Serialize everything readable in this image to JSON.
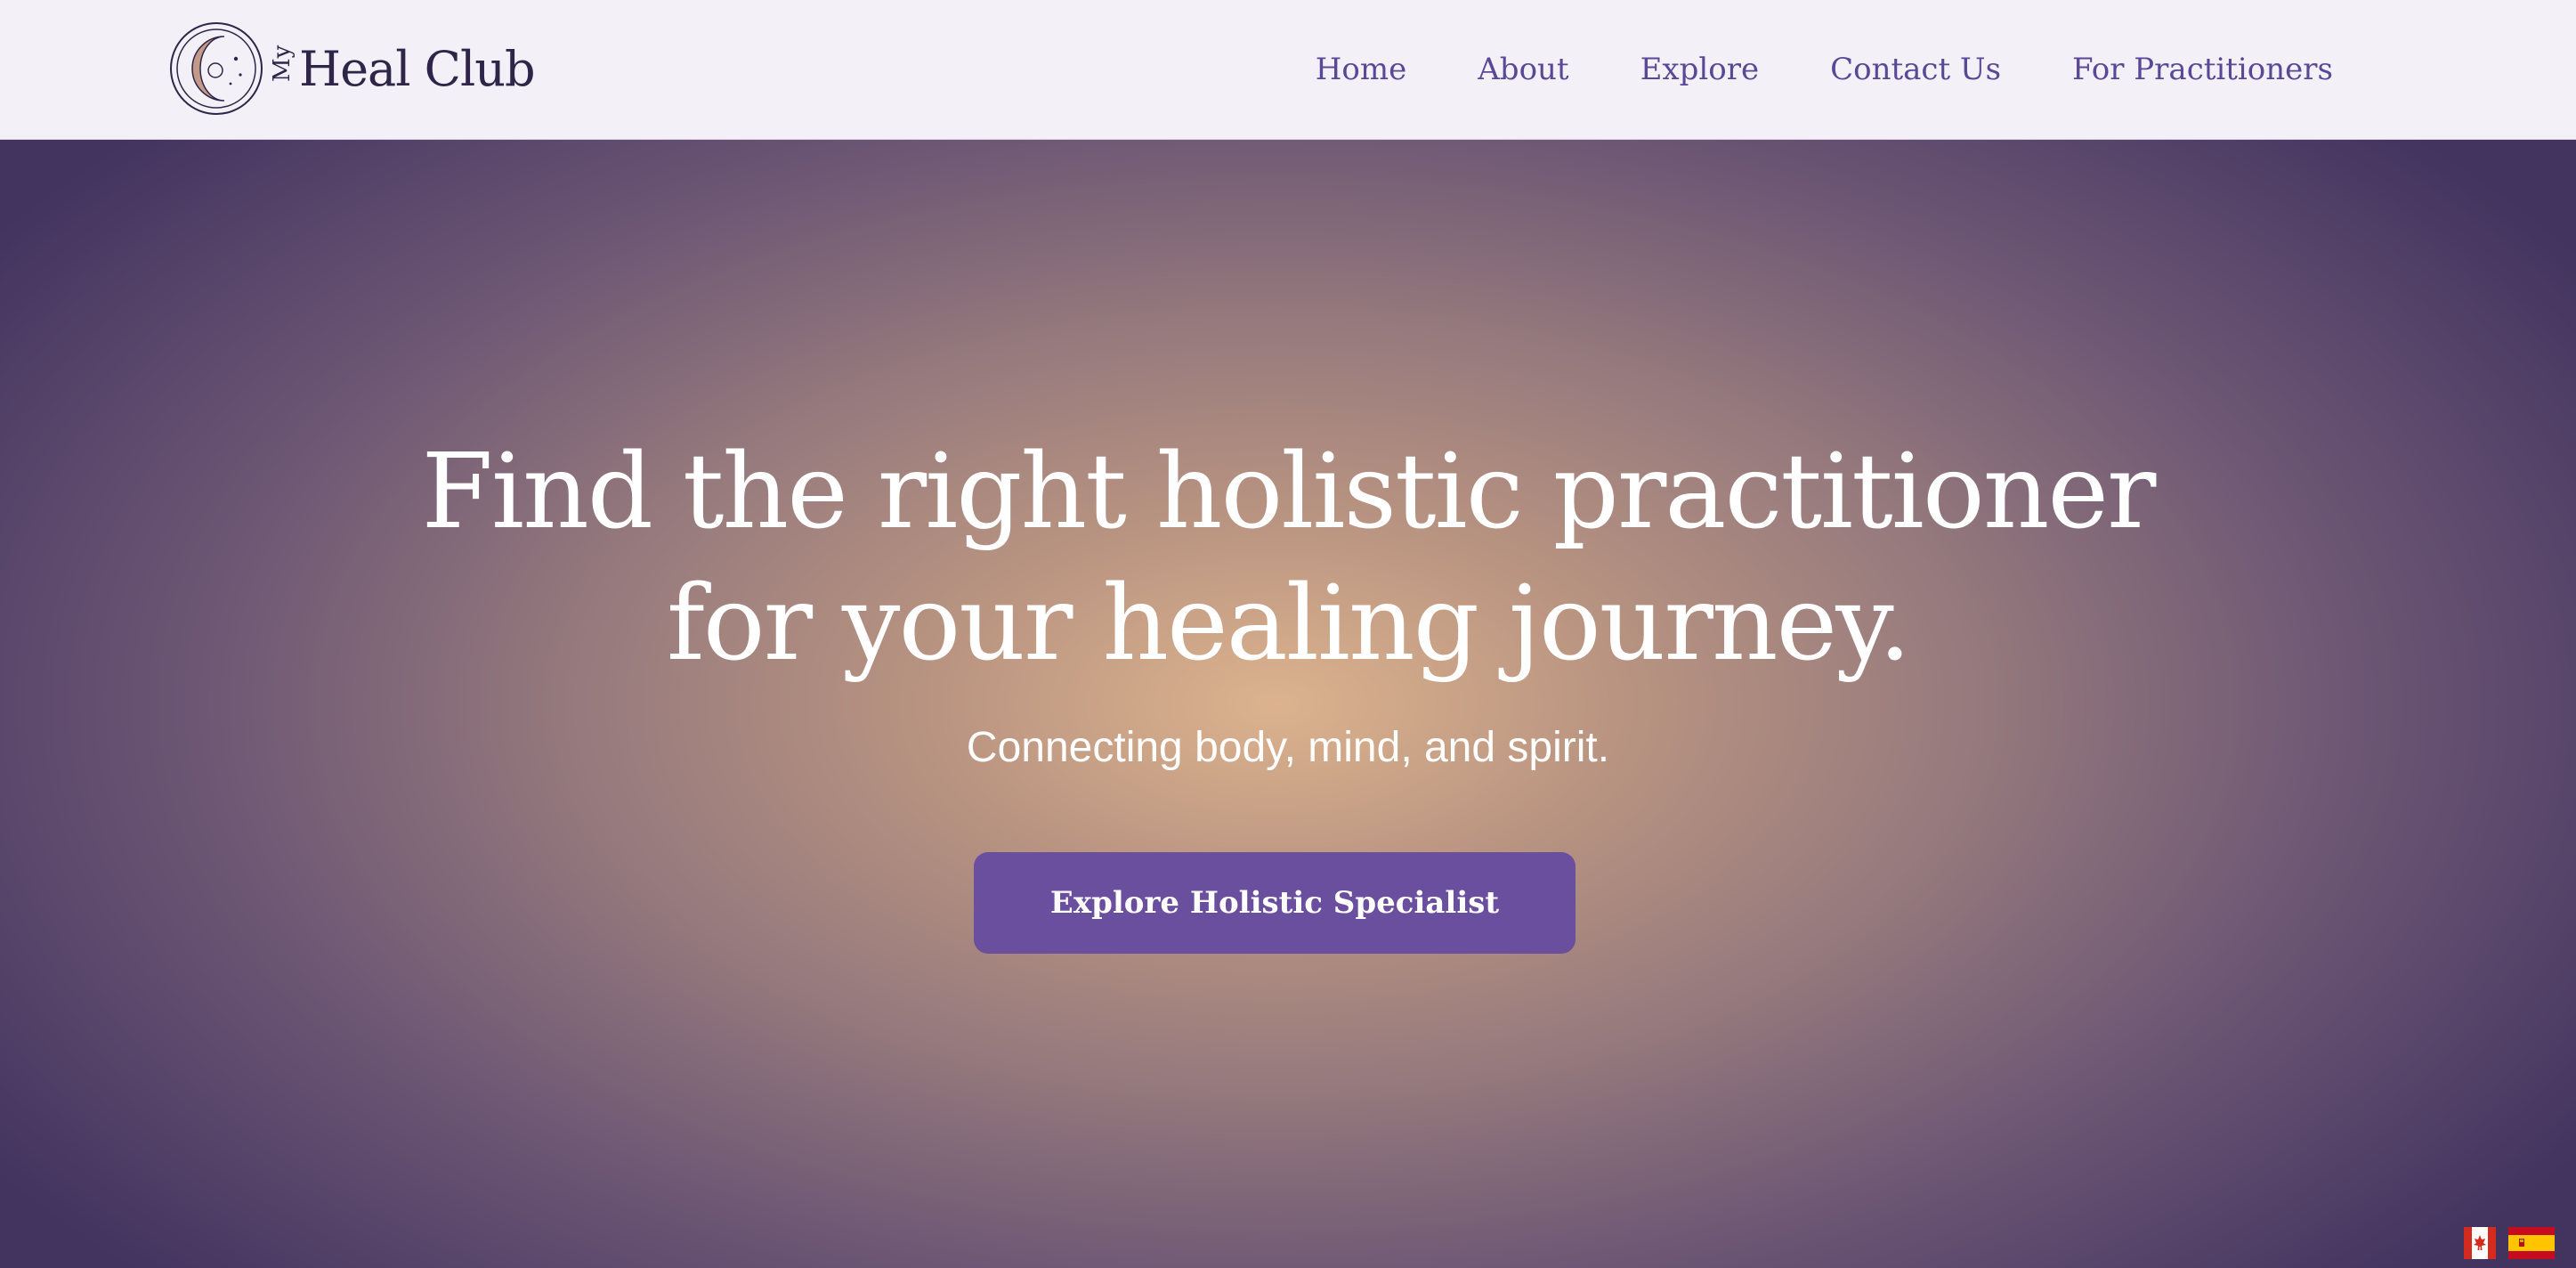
{
  "header": {
    "logo": {
      "prefix": "My",
      "name": "Heal Club"
    },
    "nav": [
      {
        "label": "Home"
      },
      {
        "label": "About"
      },
      {
        "label": "Explore"
      },
      {
        "label": "Contact Us"
      },
      {
        "label": "For Practitioners"
      }
    ]
  },
  "hero": {
    "title_line1": "Find the right holistic practitioner",
    "title_line2": "for your healing journey.",
    "subtitle": "Connecting body, mind, and spirit.",
    "cta_label": "Explore Holistic Specialist"
  },
  "language_flags": [
    {
      "icon": "canada-flag-icon"
    },
    {
      "icon": "spain-flag-icon"
    }
  ],
  "colors": {
    "brand_dark": "#2e2548",
    "nav_text": "#5a4896",
    "cta_background": "#6a4f9e",
    "header_background": "#f3f0f7",
    "hero_center": "#dcb38e",
    "hero_edge": "#42335f"
  }
}
